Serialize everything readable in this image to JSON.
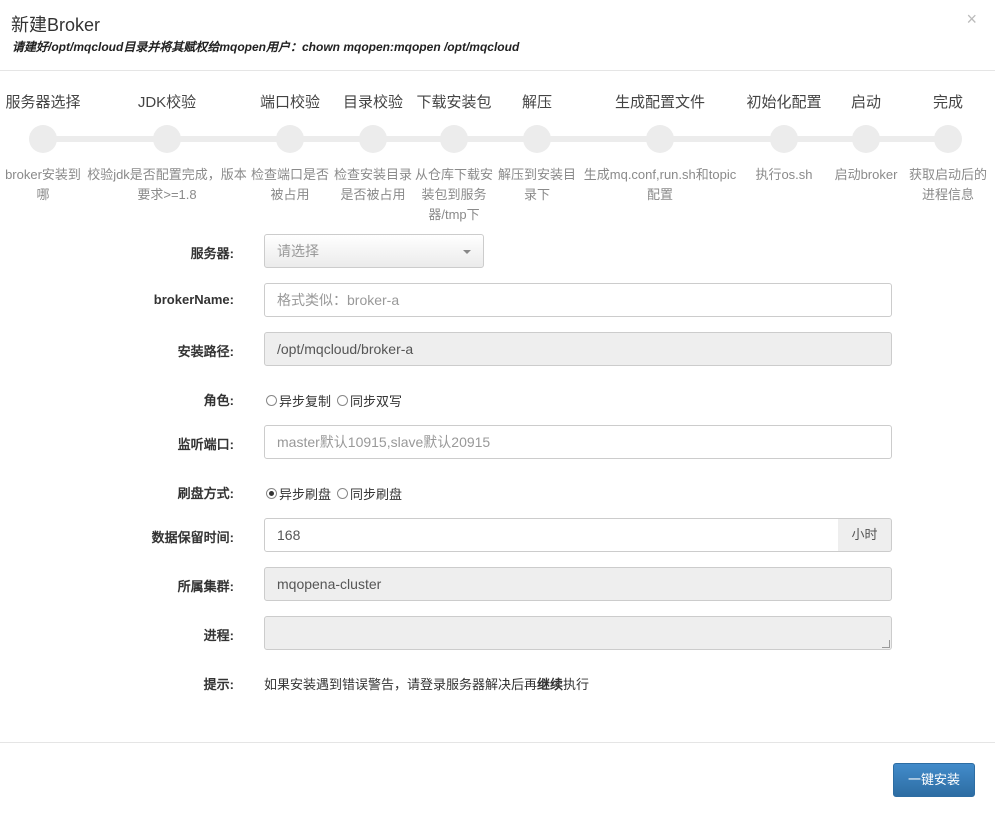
{
  "header": {
    "title": "新建Broker",
    "subtitle": "请建好/opt/mqcloud目录并将其赋权给mqopen用户：chown mqopen:mqopen /opt/mqcloud",
    "close_glyph": "×"
  },
  "steps": [
    {
      "title": "服务器选择",
      "desc": "broker安装到哪"
    },
    {
      "title": "JDK校验",
      "desc": "校验jdk是否配置完成，版本要求>=1.8"
    },
    {
      "title": "端口校验",
      "desc": "检查端口是否被占用"
    },
    {
      "title": "目录校验",
      "desc": "检查安装目录是否被占用"
    },
    {
      "title": "下载安装包",
      "desc": "从仓库下载安装包到服务器/tmp下"
    },
    {
      "title": "解压",
      "desc": "解压到安装目录下"
    },
    {
      "title": "生成配置文件",
      "desc": "生成mq.conf,run.sh和topic配置"
    },
    {
      "title": "初始化配置",
      "desc": "执行os.sh"
    },
    {
      "title": "启动",
      "desc": "启动broker"
    },
    {
      "title": "完成",
      "desc": "获取启动后的进程信息"
    }
  ],
  "form": {
    "server": {
      "label": "服务器:",
      "value": "请选择"
    },
    "broker_name": {
      "label": "brokerName:",
      "placeholder": "格式类似：broker-a"
    },
    "install_path": {
      "label": "安装路径:",
      "value": "/opt/mqcloud/broker-a"
    },
    "role": {
      "label": "角色:",
      "options": [
        "异步复制",
        "同步双写"
      ],
      "selected": null
    },
    "listen_port": {
      "label": "监听端口:",
      "placeholder": "master默认10915,slave默认20915"
    },
    "flush": {
      "label": "刷盘方式:",
      "options": [
        "异步刷盘",
        "同步刷盘"
      ],
      "selected": 0
    },
    "retention": {
      "label": "数据保留时间:",
      "value": "168",
      "unit": "小时"
    },
    "cluster": {
      "label": "所属集群:",
      "value": "mqopena-cluster"
    },
    "progress": {
      "label": "进程:",
      "value": ""
    },
    "tip": {
      "label": "提示:",
      "text_before": "如果安装遇到错误警告，请登录服务器解决后再",
      "text_bold": "继续",
      "text_after": "执行"
    }
  },
  "footer": {
    "install_button": "一键安装"
  }
}
